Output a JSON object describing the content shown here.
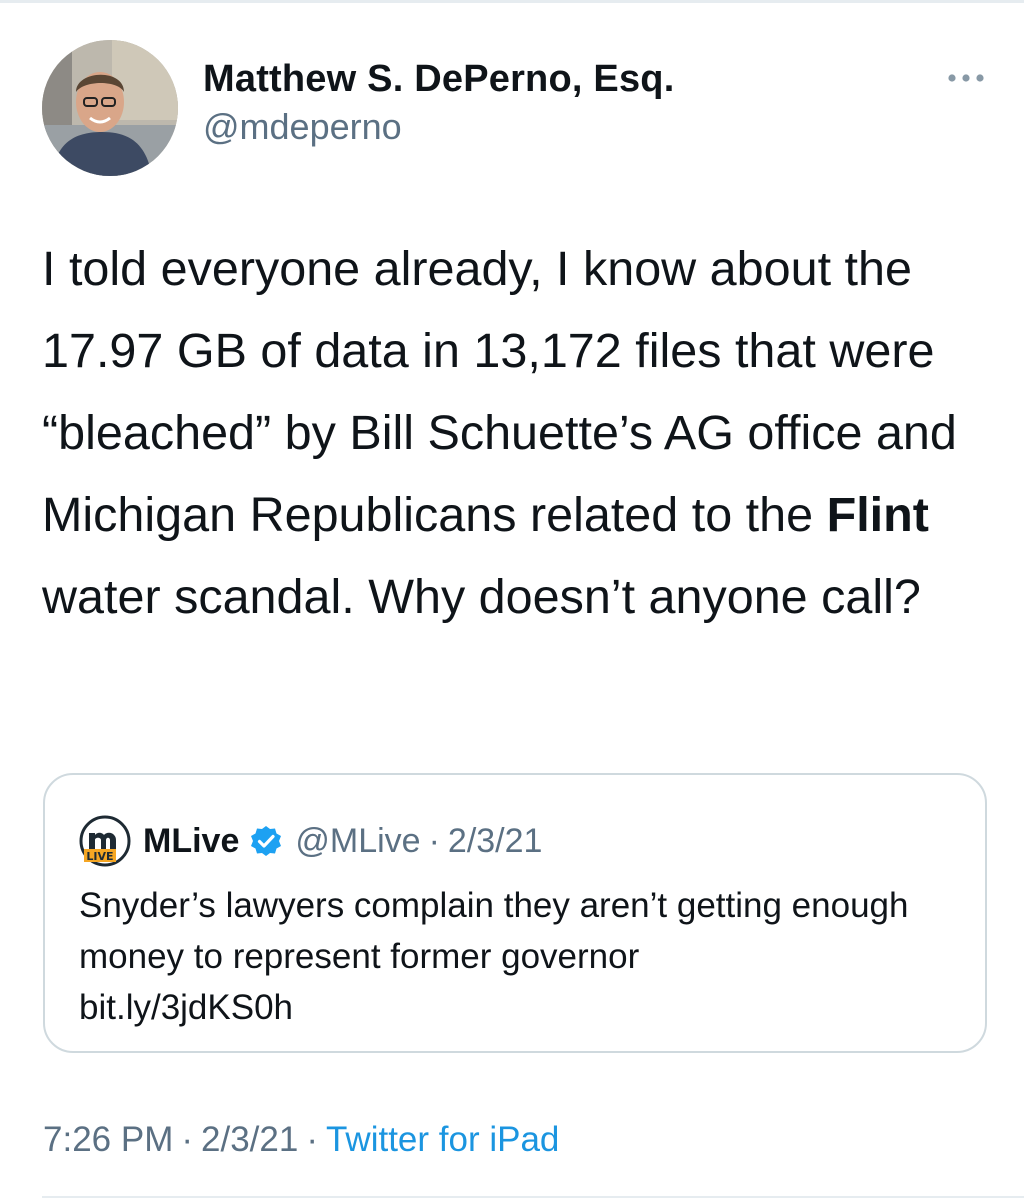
{
  "author": {
    "display_name": "Matthew S. DePerno, Esq.",
    "handle": "@mdeperno",
    "avatar_icon": "person-photo-avatar"
  },
  "more_icon": "ellipsis-icon",
  "tweet": {
    "text_before": "I told everyone already, I know about the 17.97 GB of data in 13,172 files that were “bleached” by Bill Schuette’s AG office and Michigan Republicans related to the ",
    "text_bold": "Flint",
    "text_after": " water scandal. Why doesn’t anyone call?"
  },
  "quoted_tweet": {
    "logo_icon": "mlive-logo-icon",
    "name": "MLive",
    "verified_icon": "verified-badge-icon",
    "handle": "@MLive",
    "separator": "·",
    "date": "2/3/21",
    "text": "Snyder’s lawyers complain they aren’t getting enough money to represent former governor",
    "link": "bit.ly/3jdKS0h"
  },
  "meta": {
    "time": "7:26 PM",
    "separator": "·",
    "date": "2/3/21",
    "source": "Twitter for iPad"
  },
  "colors": {
    "text_primary": "#0f1419",
    "text_secondary": "#5b7083",
    "link": "#1b95e0",
    "verified": "#1da1f2",
    "border": "#cfd9de"
  }
}
